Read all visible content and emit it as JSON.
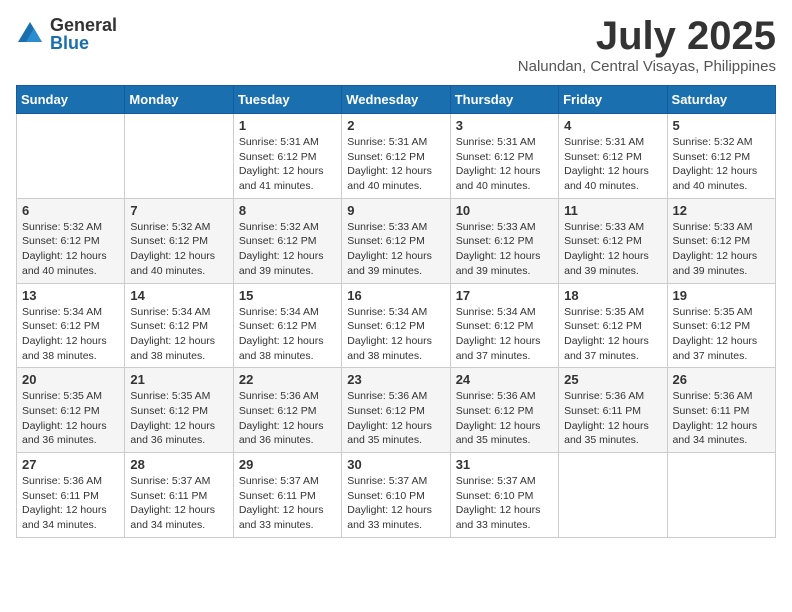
{
  "logo": {
    "general": "General",
    "blue": "Blue"
  },
  "title": "July 2025",
  "location": "Nalundan, Central Visayas, Philippines",
  "days_header": [
    "Sunday",
    "Monday",
    "Tuesday",
    "Wednesday",
    "Thursday",
    "Friday",
    "Saturday"
  ],
  "weeks": [
    [
      {
        "day": "",
        "info": ""
      },
      {
        "day": "",
        "info": ""
      },
      {
        "day": "1",
        "info": "Sunrise: 5:31 AM\nSunset: 6:12 PM\nDaylight: 12 hours and 41 minutes."
      },
      {
        "day": "2",
        "info": "Sunrise: 5:31 AM\nSunset: 6:12 PM\nDaylight: 12 hours and 40 minutes."
      },
      {
        "day": "3",
        "info": "Sunrise: 5:31 AM\nSunset: 6:12 PM\nDaylight: 12 hours and 40 minutes."
      },
      {
        "day": "4",
        "info": "Sunrise: 5:31 AM\nSunset: 6:12 PM\nDaylight: 12 hours and 40 minutes."
      },
      {
        "day": "5",
        "info": "Sunrise: 5:32 AM\nSunset: 6:12 PM\nDaylight: 12 hours and 40 minutes."
      }
    ],
    [
      {
        "day": "6",
        "info": "Sunrise: 5:32 AM\nSunset: 6:12 PM\nDaylight: 12 hours and 40 minutes."
      },
      {
        "day": "7",
        "info": "Sunrise: 5:32 AM\nSunset: 6:12 PM\nDaylight: 12 hours and 40 minutes."
      },
      {
        "day": "8",
        "info": "Sunrise: 5:32 AM\nSunset: 6:12 PM\nDaylight: 12 hours and 39 minutes."
      },
      {
        "day": "9",
        "info": "Sunrise: 5:33 AM\nSunset: 6:12 PM\nDaylight: 12 hours and 39 minutes."
      },
      {
        "day": "10",
        "info": "Sunrise: 5:33 AM\nSunset: 6:12 PM\nDaylight: 12 hours and 39 minutes."
      },
      {
        "day": "11",
        "info": "Sunrise: 5:33 AM\nSunset: 6:12 PM\nDaylight: 12 hours and 39 minutes."
      },
      {
        "day": "12",
        "info": "Sunrise: 5:33 AM\nSunset: 6:12 PM\nDaylight: 12 hours and 39 minutes."
      }
    ],
    [
      {
        "day": "13",
        "info": "Sunrise: 5:34 AM\nSunset: 6:12 PM\nDaylight: 12 hours and 38 minutes."
      },
      {
        "day": "14",
        "info": "Sunrise: 5:34 AM\nSunset: 6:12 PM\nDaylight: 12 hours and 38 minutes."
      },
      {
        "day": "15",
        "info": "Sunrise: 5:34 AM\nSunset: 6:12 PM\nDaylight: 12 hours and 38 minutes."
      },
      {
        "day": "16",
        "info": "Sunrise: 5:34 AM\nSunset: 6:12 PM\nDaylight: 12 hours and 38 minutes."
      },
      {
        "day": "17",
        "info": "Sunrise: 5:34 AM\nSunset: 6:12 PM\nDaylight: 12 hours and 37 minutes."
      },
      {
        "day": "18",
        "info": "Sunrise: 5:35 AM\nSunset: 6:12 PM\nDaylight: 12 hours and 37 minutes."
      },
      {
        "day": "19",
        "info": "Sunrise: 5:35 AM\nSunset: 6:12 PM\nDaylight: 12 hours and 37 minutes."
      }
    ],
    [
      {
        "day": "20",
        "info": "Sunrise: 5:35 AM\nSunset: 6:12 PM\nDaylight: 12 hours and 36 minutes."
      },
      {
        "day": "21",
        "info": "Sunrise: 5:35 AM\nSunset: 6:12 PM\nDaylight: 12 hours and 36 minutes."
      },
      {
        "day": "22",
        "info": "Sunrise: 5:36 AM\nSunset: 6:12 PM\nDaylight: 12 hours and 36 minutes."
      },
      {
        "day": "23",
        "info": "Sunrise: 5:36 AM\nSunset: 6:12 PM\nDaylight: 12 hours and 35 minutes."
      },
      {
        "day": "24",
        "info": "Sunrise: 5:36 AM\nSunset: 6:12 PM\nDaylight: 12 hours and 35 minutes."
      },
      {
        "day": "25",
        "info": "Sunrise: 5:36 AM\nSunset: 6:11 PM\nDaylight: 12 hours and 35 minutes."
      },
      {
        "day": "26",
        "info": "Sunrise: 5:36 AM\nSunset: 6:11 PM\nDaylight: 12 hours and 34 minutes."
      }
    ],
    [
      {
        "day": "27",
        "info": "Sunrise: 5:36 AM\nSunset: 6:11 PM\nDaylight: 12 hours and 34 minutes."
      },
      {
        "day": "28",
        "info": "Sunrise: 5:37 AM\nSunset: 6:11 PM\nDaylight: 12 hours and 34 minutes."
      },
      {
        "day": "29",
        "info": "Sunrise: 5:37 AM\nSunset: 6:11 PM\nDaylight: 12 hours and 33 minutes."
      },
      {
        "day": "30",
        "info": "Sunrise: 5:37 AM\nSunset: 6:10 PM\nDaylight: 12 hours and 33 minutes."
      },
      {
        "day": "31",
        "info": "Sunrise: 5:37 AM\nSunset: 6:10 PM\nDaylight: 12 hours and 33 minutes."
      },
      {
        "day": "",
        "info": ""
      },
      {
        "day": "",
        "info": ""
      }
    ]
  ]
}
